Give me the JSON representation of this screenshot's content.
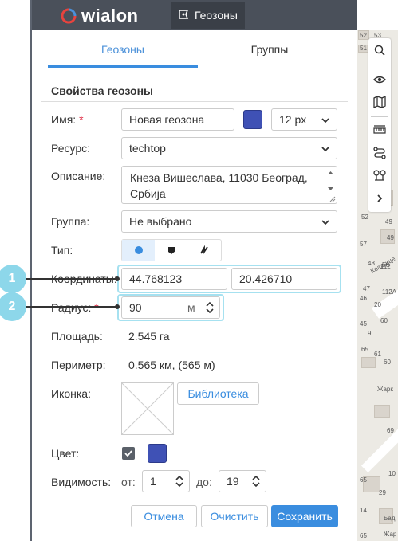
{
  "app": {
    "logo_text": "wialon",
    "module_tab": "Геозоны"
  },
  "tabs": [
    {
      "label": "Геозоны",
      "active": true
    },
    {
      "label": "Группы",
      "active": false
    }
  ],
  "form": {
    "section_title": "Свойства геозоны",
    "name": {
      "label": "Имя:",
      "required_mark": "*",
      "value": "Новая геозона",
      "font_size": "12 px",
      "color": "#3f51b5"
    },
    "resource": {
      "label": "Ресурс:",
      "value": "techtop"
    },
    "description": {
      "label": "Описание:",
      "value_line1": "Кнеза Вишеслава, 11030 Београд,",
      "value_line2": "Србија"
    },
    "group": {
      "label": "Группа:",
      "value": "Не выбрано"
    },
    "type": {
      "label": "Тип:",
      "options": [
        "circle-icon",
        "polygon-icon",
        "line-icon"
      ],
      "active": "circle-icon"
    },
    "coordinates": {
      "label": "Координаты:",
      "lat": "44.768123",
      "lon": "20.426710"
    },
    "radius": {
      "label": "Радиус:",
      "required_mark": "*",
      "value": "90",
      "unit": "м"
    },
    "area": {
      "label": "Площадь:",
      "value": "2.545 га"
    },
    "perimeter": {
      "label": "Периметр:",
      "value": "0.565 км, (565 м)"
    },
    "icon": {
      "label": "Иконка:",
      "library_button": "Библиотека"
    },
    "color": {
      "label": "Цвет:",
      "checked": true,
      "value": "#3f51b5"
    },
    "visibility": {
      "label": "Видимость:",
      "from_label": "от:",
      "from_value": "1",
      "to_label": "до:",
      "to_value": "19"
    },
    "buttons": {
      "cancel": "Отмена",
      "clear": "Очистить",
      "save": "Сохранить"
    }
  },
  "callouts": [
    {
      "number": "1"
    },
    {
      "number": "2"
    }
  ],
  "map": {
    "labels": [
      "52",
      "53",
      "51",
      "51",
      "52",
      "49",
      "49",
      "57",
      "48",
      "56",
      "47",
      "46",
      "20",
      "45",
      "60",
      "Краљице",
      "112",
      "112A",
      "9",
      "65",
      "61",
      "60",
      "Жарк",
      "69",
      "10",
      "29",
      "14",
      "Бад",
      "Жар",
      "65",
      "65"
    ]
  },
  "colors": {
    "accent": "#3a8ddf",
    "topbar": "#4a505a",
    "callout": "#8dd7ea",
    "highlight": "#a6e1f0",
    "required": "#e0334a"
  }
}
